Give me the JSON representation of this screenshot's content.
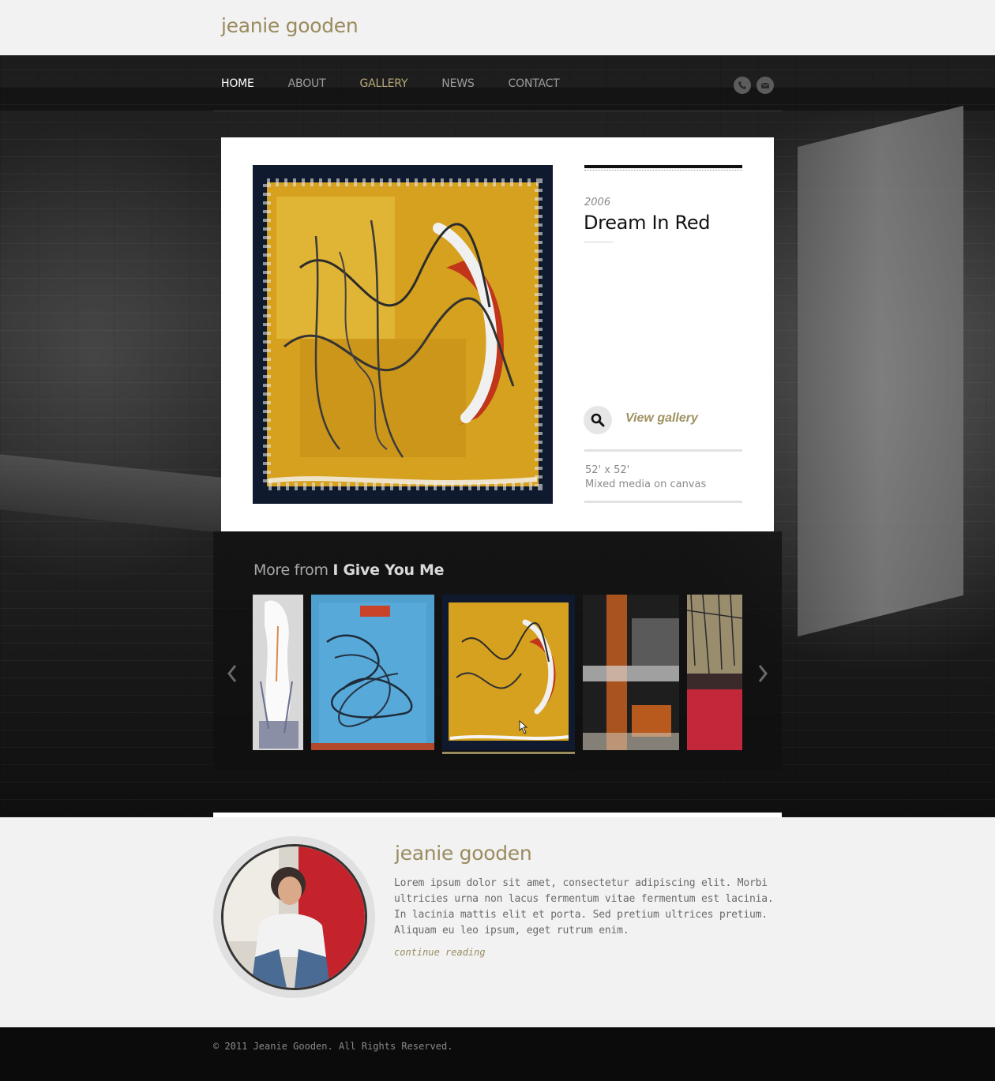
{
  "header": {
    "logo": "jeanie gooden"
  },
  "nav": {
    "items": [
      "HOME",
      "ABOUT",
      "GALLERY",
      "NEWS",
      "CONTACT"
    ],
    "active": "HOME",
    "highlighted": "GALLERY",
    "social_icons": [
      "phone-icon",
      "mail-icon"
    ]
  },
  "featured": {
    "year": "2006",
    "title": "Dream In Red",
    "view_gallery": "View gallery",
    "dimensions": "52' x 52'",
    "medium": "Mixed media on canvas"
  },
  "more": {
    "prefix": "More from ",
    "collection": "I Give You Me",
    "selected_index": 2
  },
  "bio": {
    "name": "jeanie gooden",
    "text": "Lorem ipsum dolor sit amet, consectetur adipiscing elit. Morbi ultricies urna non lacus fermentum vitae fermentum est lacinia. In lacinia mattis elit et porta. Sed pretium ultrices pretium. Aliquam eu leo ipsum, eget rutrum enim.",
    "link": "continue reading"
  },
  "footer": {
    "copyright": "© 2011 Jeanie Gooden. All Rights Reserved."
  },
  "colors": {
    "accent": "#9a8b5f",
    "dark": "#0b0b0b",
    "light_bg": "#f2f2f2"
  }
}
